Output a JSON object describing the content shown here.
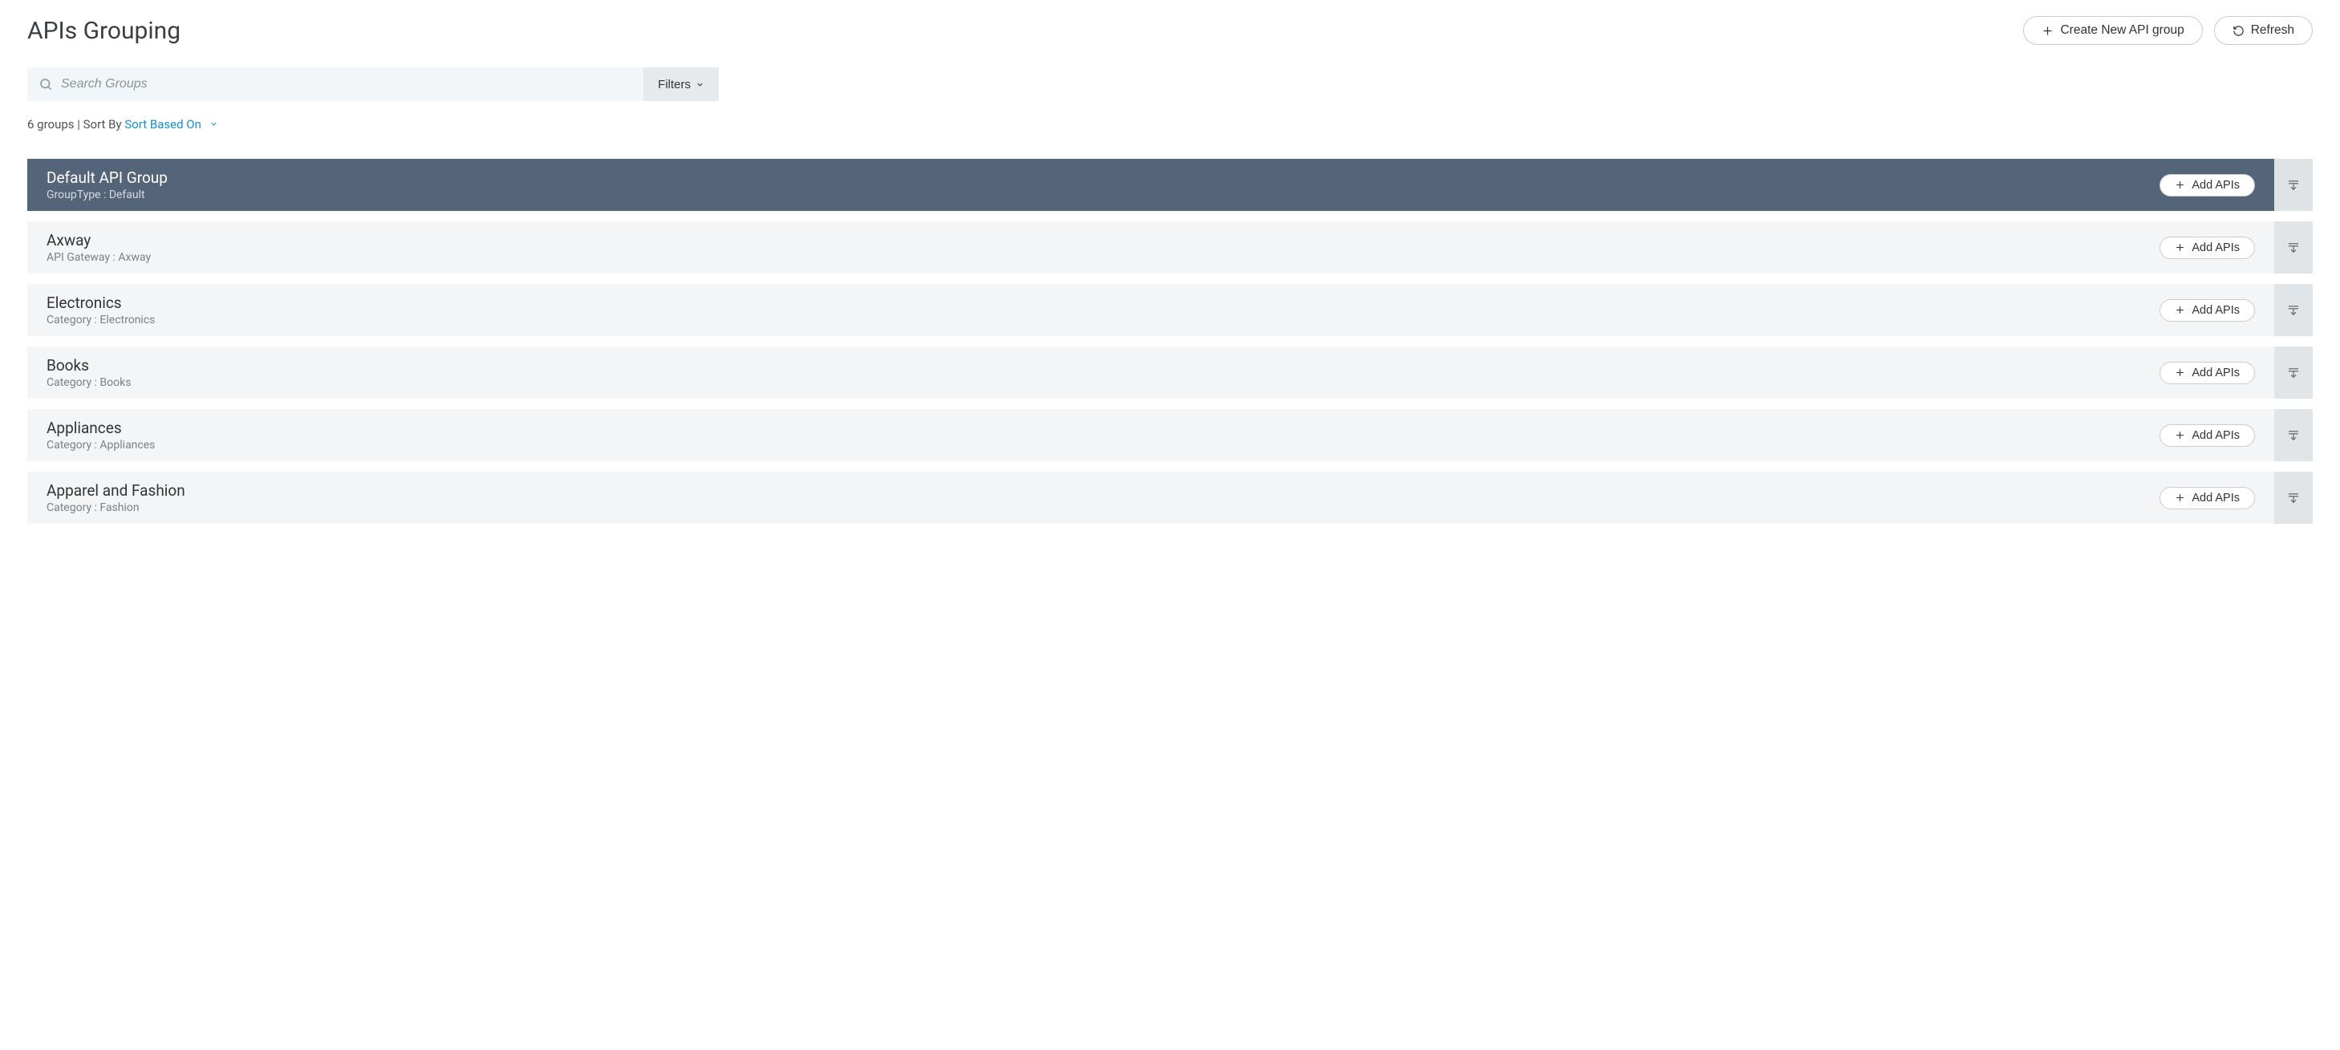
{
  "header": {
    "title": "APIs Grouping",
    "create_label": "Create New API group",
    "refresh_label": "Refresh"
  },
  "search": {
    "placeholder": "Search Groups",
    "filters_label": "Filters"
  },
  "summary": {
    "count_text": "6 groups",
    "sort_prefix": "Sort By",
    "sort_value": "Sort Based On"
  },
  "groups": [
    {
      "title": "Default API Group",
      "subtitle": "GroupType : Default",
      "selected": true
    },
    {
      "title": "Axway",
      "subtitle": "API Gateway : Axway",
      "selected": false
    },
    {
      "title": "Electronics",
      "subtitle": "Category : Electronics",
      "selected": false
    },
    {
      "title": "Books",
      "subtitle": "Category : Books",
      "selected": false
    },
    {
      "title": "Appliances",
      "subtitle": "Category : Appliances",
      "selected": false
    },
    {
      "title": "Apparel and Fashion",
      "subtitle": "Category : Fashion",
      "selected": false
    }
  ],
  "labels": {
    "add_apis": "Add APIs"
  }
}
